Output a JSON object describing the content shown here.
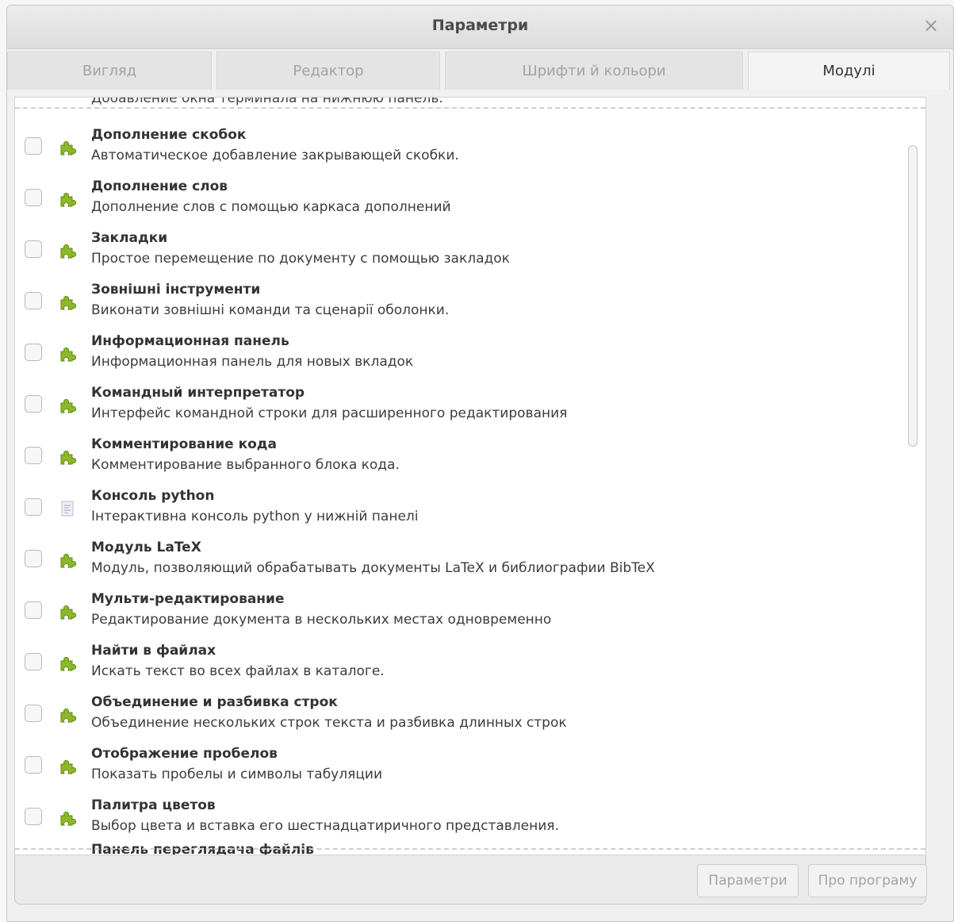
{
  "window": {
    "title": "Параметри",
    "close_label": "×"
  },
  "tabs": [
    {
      "label": "Вигляд",
      "active": false
    },
    {
      "label": "Редактор",
      "active": false
    },
    {
      "label": "Шрифти й кольори",
      "active": false
    },
    {
      "label": "Модулі",
      "active": true
    }
  ],
  "plugins": {
    "clipped_top_text": "Добавление окна терминала на нижнюю панель.",
    "items": [
      {
        "name": "Дополнение скобок",
        "description": "Автоматическое добавление закрывающей скобки.",
        "icon": "puzzle-icon"
      },
      {
        "name": "Дополнение слов",
        "description": "Дополнение слов с помощью каркаса дополнений",
        "icon": "puzzle-icon"
      },
      {
        "name": "Закладки",
        "description": "Простое перемещение по документу с помощью закладок",
        "icon": "puzzle-icon"
      },
      {
        "name": "Зовнішні інструменти",
        "description": "Виконати зовнішні команди та сценарії оболонки.",
        "icon": "puzzle-icon"
      },
      {
        "name": "Информационная панель",
        "description": "Информационная панель для новых вкладок",
        "icon": "puzzle-icon"
      },
      {
        "name": "Командный интерпретатор",
        "description": "Интерфейс командной строки для расширенного редактирования",
        "icon": "puzzle-icon"
      },
      {
        "name": "Комментирование кода",
        "description": "Комментирование выбранного блока кода.",
        "icon": "puzzle-icon"
      },
      {
        "name": "Консоль python",
        "description": "Інтерактивна консоль python у нижній панелі",
        "icon": "console-icon"
      },
      {
        "name": "Модуль LaTeX",
        "description": "Модуль, позволяющий обрабатывать документы LaTeX и библиографии BibTeX",
        "icon": "puzzle-icon"
      },
      {
        "name": "Мульти-редактирование",
        "description": "Редактирование документа в нескольких местах одновременно",
        "icon": "puzzle-icon"
      },
      {
        "name": "Найти в файлах",
        "description": "Искать текст во всех файлах в каталоге.",
        "icon": "puzzle-icon"
      },
      {
        "name": "Объединение и разбивка строк",
        "description": "Объединение нескольких строк текста и разбивка длинных строк",
        "icon": "puzzle-icon"
      },
      {
        "name": "Отображение пробелов",
        "description": "Показать пробелы и символы табуляции",
        "icon": "puzzle-icon"
      },
      {
        "name": "Палитра цветов",
        "description": "Выбор цвета и вставка его шестнадцатиричного представления.",
        "icon": "puzzle-icon"
      }
    ],
    "clipped_bottom_name": "Панель переглядача файлів"
  },
  "footer": {
    "params_label": "Параметри",
    "about_label": "Про програму"
  },
  "colors": {
    "puzzle": "#8cb82a",
    "puzzle_dark": "#5f8a12"
  }
}
